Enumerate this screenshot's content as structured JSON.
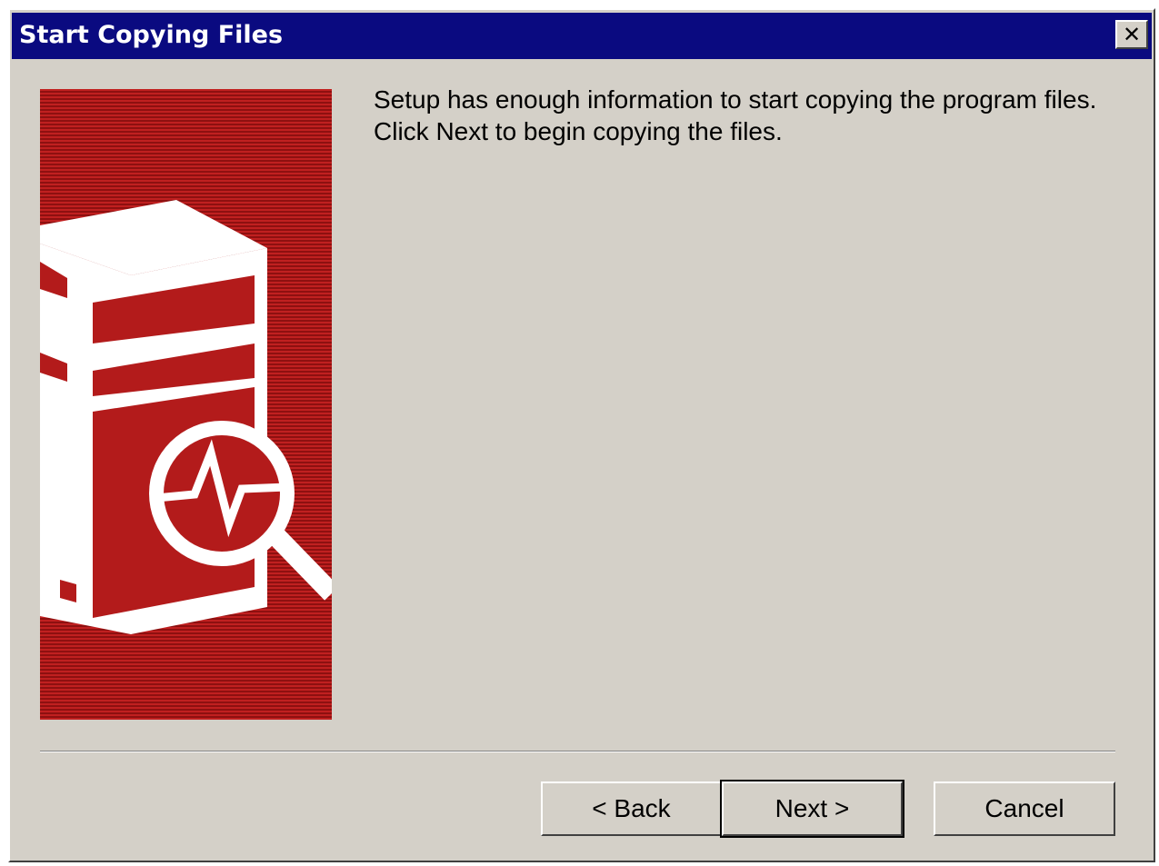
{
  "window": {
    "title": "Start Copying Files",
    "close_icon": "close-icon"
  },
  "banner": {
    "icon": "server-diagnostics-icon",
    "colors": {
      "stripe_light": "#c02020",
      "stripe_dark": "#8e1010",
      "artwork": "#ffffff"
    }
  },
  "message": {
    "line1": "Setup has enough information to start copying the program files.",
    "line2": "Click Next to begin copying the files."
  },
  "buttons": {
    "back_label": "< Back",
    "next_label": "Next >",
    "cancel_label": "Cancel"
  },
  "colors": {
    "titlebar": "#0a0a80",
    "dialog_face": "#d4d0c8"
  }
}
